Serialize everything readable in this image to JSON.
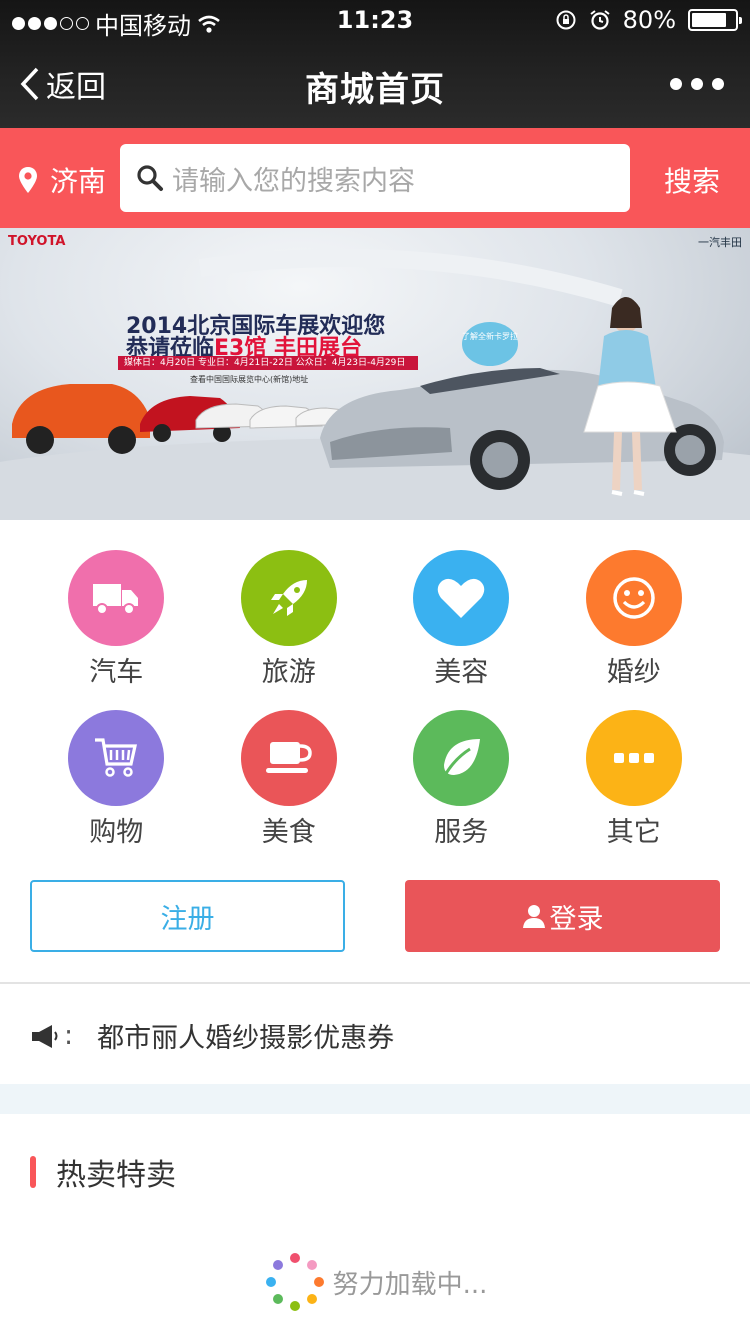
{
  "status_bar": {
    "carrier": "中国移动",
    "time": "11:23",
    "battery": "80%",
    "battery_level": 0.8
  },
  "nav": {
    "back_label": "返回",
    "title": "商城首页"
  },
  "search": {
    "city": "济南",
    "placeholder": "请输入您的搜索内容",
    "button_label": "搜索"
  },
  "banner": {
    "brand": "TOYOTA",
    "brand_right": "一汽丰田",
    "headline_1": "2014北京国际车展欢迎您",
    "headline_2_prefix": "恭请莅临",
    "headline_2_highlight": "E3馆 丰田展台",
    "dates": "媒体日：4月20日  专业日：4月21日-22日  公众日：4月23日-4月29日",
    "address": "查看中国国际展览中心(新馆)地址",
    "bubble": "了解全新卡罗拉"
  },
  "categories": [
    {
      "label": "汽车",
      "icon": "truck-icon",
      "color": "#f06fac"
    },
    {
      "label": "旅游",
      "icon": "rocket-icon",
      "color": "#8cbf12"
    },
    {
      "label": "美容",
      "icon": "heart-icon",
      "color": "#3ab1f0"
    },
    {
      "label": "婚纱",
      "icon": "smiley-icon",
      "color": "#fd7a2e"
    },
    {
      "label": "购物",
      "icon": "cart-icon",
      "color": "#8c79dd"
    },
    {
      "label": "美食",
      "icon": "coffee-cup-icon",
      "color": "#ea5558"
    },
    {
      "label": "服务",
      "icon": "leaf-icon",
      "color": "#5cba5b"
    },
    {
      "label": "其它",
      "icon": "ellipsis-icon",
      "color": "#fcb316"
    }
  ],
  "auth": {
    "register_label": "注册",
    "login_label": "登录"
  },
  "notice": {
    "colon": ":",
    "text": "都市丽人婚纱摄影优惠券"
  },
  "hot_section": {
    "title": "热卖特卖"
  },
  "loading": {
    "text": "努力加载中..."
  },
  "colors": {
    "accent_red": "#f95659",
    "login_red": "#e95559",
    "register_blue": "#3aaee6"
  }
}
